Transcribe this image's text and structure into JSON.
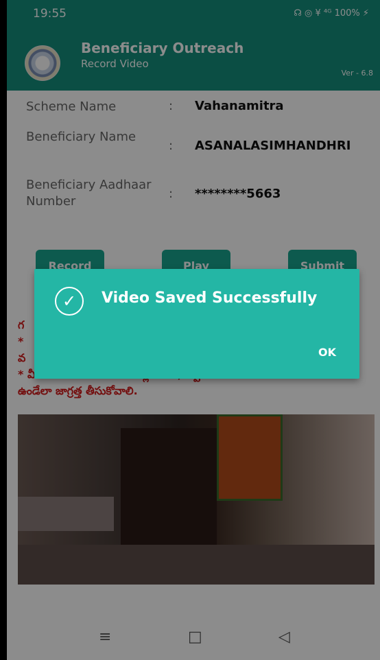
{
  "status_bar": {
    "time": "19:55",
    "icons_text": "☊ ◎ ¥  ⁴ᴳ  100% ⚡"
  },
  "app_bar": {
    "title": "Beneficiary Outreach",
    "subtitle": "Record Video",
    "version": "Ver - 6.8"
  },
  "fields": [
    {
      "label": "Scheme Name",
      "value": "Vahanamitra"
    },
    {
      "label": "Beneficiary Name",
      "value": "ASANALASIMHANDHRI"
    },
    {
      "label": "Beneficiary Aadhaar Number",
      "value": "********5663"
    }
  ],
  "buttons": {
    "record": "Record",
    "play": "Play",
    "submit": "Submit"
  },
  "note_lines": [
    "గ",
    "* ",
    "వ",
    "* వీడియో మరియు ఆడియో క్లారిటిగా, క్వాలిటిగా",
    "ఉండేలా జాగ్రత్త తీసుకోవాలి."
  ],
  "dialog": {
    "message": "Video Saved Successfully",
    "ok_label": "OK"
  },
  "nav": {
    "menu_icon": "≡",
    "home_icon": "□",
    "back_icon": "◁"
  }
}
